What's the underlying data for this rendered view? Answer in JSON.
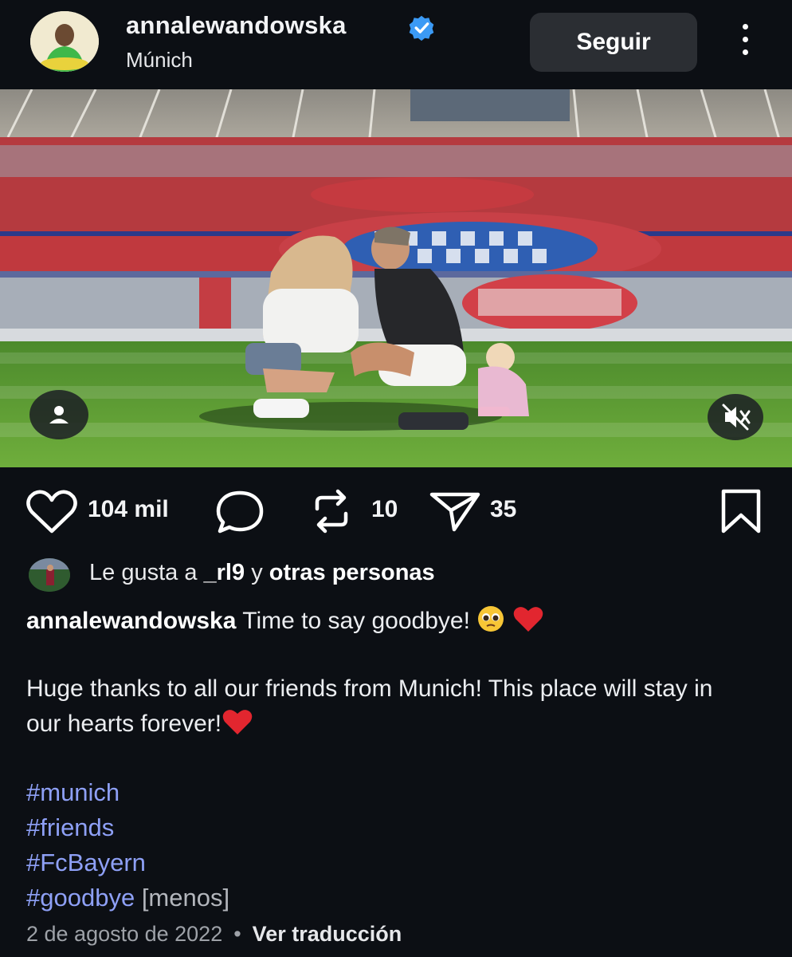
{
  "post": {
    "username": "annalewandowska",
    "location": "Múnich",
    "follow_label": "Seguir"
  },
  "stats": {
    "likes": "104 mil",
    "reposts": "10",
    "shares": "35"
  },
  "liked_by": {
    "prefix": "Le gusta a",
    "user": "_rl9",
    "connector": "y",
    "others": "otras personas"
  },
  "caption": {
    "author": "annalewandowska",
    "line1": "Time to say goodbye!",
    "paragraph2": "Huge thanks to all our friends from Munich! This place will stay in our hearts forever!",
    "hashtags": [
      "#munich",
      "#friends",
      "#FcBayern",
      "#goodbye"
    ],
    "less_label": "[menos]"
  },
  "footer": {
    "date": "2 de agosto de 2022",
    "separator": "•",
    "translate_label": "Ver traducción"
  },
  "icons": {
    "verified": "verified-badge-icon",
    "more": "more-options-icon",
    "tag": "user-tag-icon",
    "mute": "sound-off-icon",
    "like": "heart-icon",
    "comment": "comment-icon",
    "repost": "repost-icon",
    "share": "send-icon",
    "save": "bookmark-icon"
  },
  "colors": {
    "background": "#0c0f14",
    "accent_verified": "#3b9af5",
    "hashtag": "#8ea0f6",
    "button": "#2b2e33"
  }
}
